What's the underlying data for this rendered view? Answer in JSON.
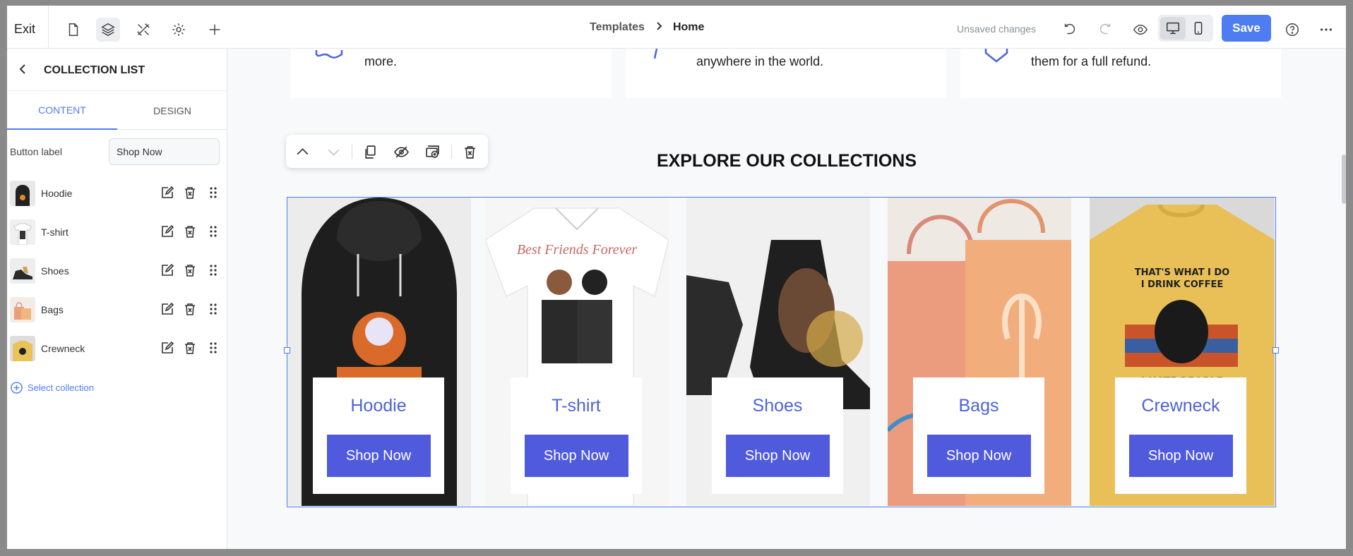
{
  "topbar": {
    "exit_label": "Exit",
    "breadcrumb": [
      "Templates",
      "Home"
    ],
    "unsaved_label": "Unsaved changes",
    "save_label": "Save"
  },
  "panel": {
    "title": "COLLECTION LIST",
    "tabs": [
      "CONTENT",
      "DESIGN"
    ],
    "active_tab": "CONTENT",
    "button_label_field": {
      "label": "Button label",
      "value": "Shop Now"
    },
    "items": [
      {
        "label": "Hoodie"
      },
      {
        "label": "T-shirt"
      },
      {
        "label": "Shoes"
      },
      {
        "label": "Bags"
      },
      {
        "label": "Crewneck"
      }
    ],
    "select_collection": "Select collection"
  },
  "canvas": {
    "info_cards": [
      {
        "text": "more."
      },
      {
        "text": "anywhere in the world."
      },
      {
        "text": "them for a full refund."
      }
    ],
    "section_title": "EXPLORE OUR COLLECTIONS",
    "collections": [
      {
        "title": "Hoodie",
        "button": "Shop Now"
      },
      {
        "title": "T-shirt",
        "button": "Shop Now"
      },
      {
        "title": "Shoes",
        "button": "Shop Now"
      },
      {
        "title": "Bags",
        "button": "Shop Now"
      },
      {
        "title": "Crewneck",
        "button": "Shop Now"
      }
    ]
  },
  "colors": {
    "accent": "#4d7df0",
    "button": "#4f5bdc",
    "collection_title": "#4d63d8"
  }
}
